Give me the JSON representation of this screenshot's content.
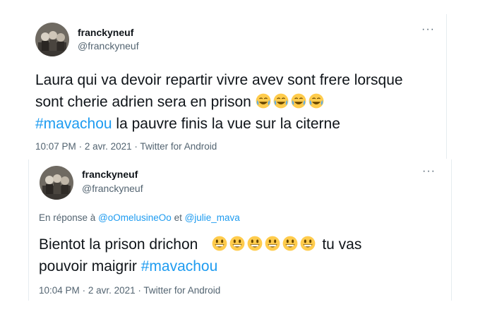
{
  "tweet1": {
    "name": "franckyneuf",
    "handle": "@franckyneuf",
    "more": "···",
    "text_line1": "Laura qui va devoir repartir vivre avev sont frere lorsque",
    "text_line2_start": "sont cherie adrien sera en prison ",
    "emoji_line2": [
      "face-with-tears-of-joy",
      "face-with-tears-of-joy",
      "face-with-tears-of-joy",
      "face-with-tears-of-joy"
    ],
    "hashtag": "#mavachou",
    "text_line3_rest": " la pauvre finis la vue sur la citerne",
    "time": "10:07 PM",
    "date": "2 avr. 2021",
    "source": "Twitter for Android",
    "sep": "·"
  },
  "tweet2": {
    "name": "franckyneuf",
    "handle": "@franckyneuf",
    "more": "···",
    "reply_prefix": "En réponse à ",
    "mention1": "@oOmelusineOo",
    "reply_and": " et ",
    "mention2": "@julie_mava",
    "text_start": "Bientot la prison drichon",
    "emoji": [
      "grinning-face",
      "grinning-face",
      "grinning-face",
      "grinning-face",
      "grinning-face",
      "grinning-face"
    ],
    "text_after_emoji": "tu vas",
    "text_line2_start": "pouvoir maigrir ",
    "hashtag": "#mavachou",
    "time": "10:04 PM",
    "date": "2 avr. 2021",
    "source": "Twitter for Android",
    "sep": "·"
  },
  "colors": {
    "accent": "#1d9bf0",
    "secondary": "#536471",
    "text": "#0f1419",
    "emoji": "#ffcc4d"
  }
}
